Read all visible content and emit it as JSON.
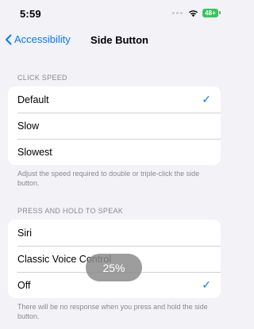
{
  "status": {
    "time": "5:59",
    "battery": "48+",
    "battery_color": "#34c759"
  },
  "nav": {
    "back_label": "Accessibility",
    "title": "Side Button"
  },
  "click_speed": {
    "header": "CLICK SPEED",
    "options": [
      "Default",
      "Slow",
      "Slowest"
    ],
    "selected": "Default",
    "footer": "Adjust the speed required to double or triple-click the side button."
  },
  "press_hold": {
    "header": "PRESS AND HOLD TO SPEAK",
    "options": [
      "Siri",
      "Classic Voice Control",
      "Off"
    ],
    "selected": "Off",
    "footer": "There will be no response when you press and hold the side button."
  },
  "toast": {
    "text": "25%"
  },
  "accent_color": "#007aff"
}
